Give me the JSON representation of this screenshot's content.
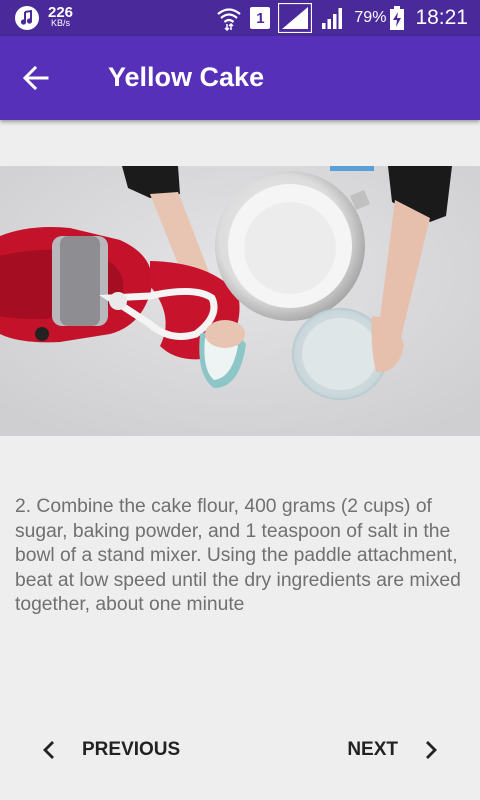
{
  "status_bar": {
    "net_speed_value": "226",
    "net_speed_unit": "KB/s",
    "sim_slot": "1",
    "battery_percent": "79%",
    "time": "18:21"
  },
  "app_bar": {
    "title": "Yellow Cake",
    "back_icon": "arrow-back-icon"
  },
  "step": {
    "text": "2. Combine the cake flour, 400 grams (2 cups) of sugar, baking powder, and 1 teaspoon of salt in the bowl of a stand mixer. Using the paddle attachment, beat at low speed until the dry ingredients are mixed together, about one minute"
  },
  "navigation": {
    "previous_label": "PREVIOUS",
    "next_label": "NEXT"
  },
  "colors": {
    "status_bar": "#4a2a9a",
    "app_bar": "#5630b8",
    "background": "#eeeeee",
    "step_text": "#707070"
  }
}
